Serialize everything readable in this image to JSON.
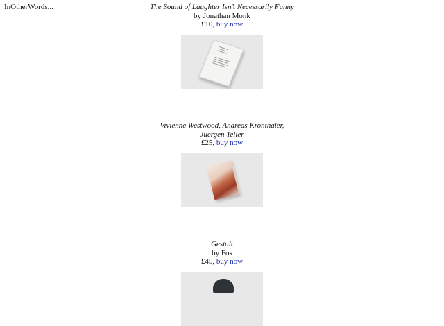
{
  "site": {
    "title": "InOtherWords..."
  },
  "products": [
    {
      "title": "The Sound of Laughter Isn’t Necessarily Funny",
      "author": "by Jonathan Monk",
      "price": "£10,",
      "buy_label": "buy now"
    },
    {
      "title": "Vivienne Westwood, Andreas Kronthaler, Juergen Teller",
      "author": "",
      "price": "£25,",
      "buy_label": "buy now"
    },
    {
      "title": "Gestalt",
      "author": "by Fos",
      "price": "£45,",
      "buy_label": "buy now"
    }
  ]
}
